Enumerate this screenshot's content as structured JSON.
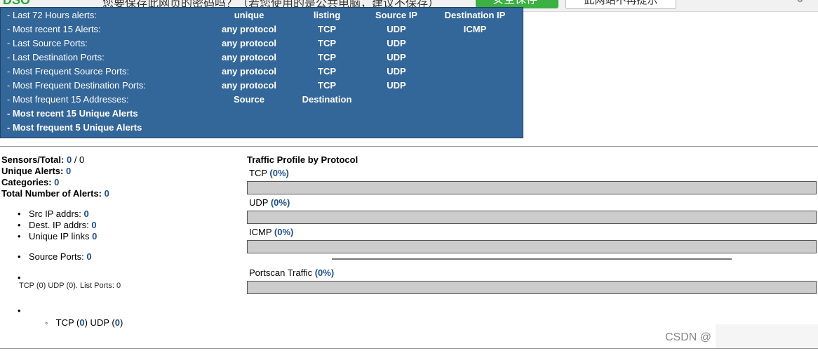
{
  "browser_bar": {
    "brand": "DSO",
    "prompt": "您要保存此网页的密码吗？（若您使用的是公共电脑，建议不保存）",
    "save_button": "安全保存",
    "never_button": "此网站不再提示"
  },
  "menu": {
    "rows": [
      {
        "label": "- Last 72 Hours alerts:",
        "bold": false,
        "options": [
          "unique",
          "listing",
          "Source IP",
          "Destination IP"
        ]
      },
      {
        "label": "- Most recent 15 Alerts:",
        "bold": false,
        "options": [
          "any protocol",
          "TCP",
          "UDP",
          "ICMP"
        ]
      },
      {
        "label": "- Last Source Ports:",
        "bold": false,
        "options": [
          "any protocol",
          "TCP",
          "UDP"
        ]
      },
      {
        "label": "- Last Destination Ports:",
        "bold": false,
        "options": [
          "any protocol",
          "TCP",
          "UDP"
        ]
      },
      {
        "label": "- Most Frequent Source Ports:",
        "bold": false,
        "options": [
          "any protocol",
          "TCP",
          "UDP"
        ]
      },
      {
        "label": "- Most Frequent Destination Ports:",
        "bold": false,
        "options": [
          "any protocol",
          "TCP",
          "UDP"
        ]
      },
      {
        "label": "- Most frequent 15 Addresses:",
        "bold": false,
        "options": [
          "Source",
          "Destination"
        ]
      },
      {
        "label": "- Most recent 15 Unique Alerts",
        "bold": true,
        "options": []
      },
      {
        "label": "- Most frequent 5 Unique Alerts",
        "bold": true,
        "options": []
      }
    ]
  },
  "stats": {
    "sensors_label": "Sensors/Total:",
    "sensors_value": "0",
    "sensors_sep": " / ",
    "sensors_total": "0",
    "unique_alerts_label": "Unique Alerts:",
    "unique_alerts_value": "0",
    "categories_label": "Categories:",
    "categories_value": "0",
    "total_alerts_label": "Total Number of Alerts:",
    "total_alerts_value": "0"
  },
  "ip_list": [
    {
      "label": "Src IP addrs:",
      "value": "0"
    },
    {
      "label": "Dest. IP addrs:",
      "value": "0"
    },
    {
      "label": "Unique IP links",
      "value": "0"
    }
  ],
  "ports": {
    "source_ports_label": "Source Ports:",
    "source_ports_value": "0",
    "dest_ports_text": "TCP (0) UDP (0). List Ports: 0",
    "sub_tcp_label": "TCP (",
    "sub_tcp_value": "0",
    "sub_udp_label": ") UDP (",
    "sub_udp_value": "0",
    "sub_close": ")"
  },
  "traffic": {
    "title": "Traffic Profile by Protocol",
    "protocols": [
      {
        "name": "TCP",
        "percent_text": "(0%)",
        "percent": 0
      },
      {
        "name": "UDP",
        "percent_text": "(0%)",
        "percent": 0
      },
      {
        "name": "ICMP",
        "percent_text": "(0%)",
        "percent": 0
      }
    ],
    "portscan": {
      "name": "Portscan Traffic",
      "percent_text": "(0%)",
      "percent": 0
    }
  },
  "watermark": "CSDN @",
  "colors": {
    "menu_bg": "#336699",
    "link": "#1d4f8c",
    "bar_bg": "#cccccc",
    "save_green": "#3cb043"
  }
}
